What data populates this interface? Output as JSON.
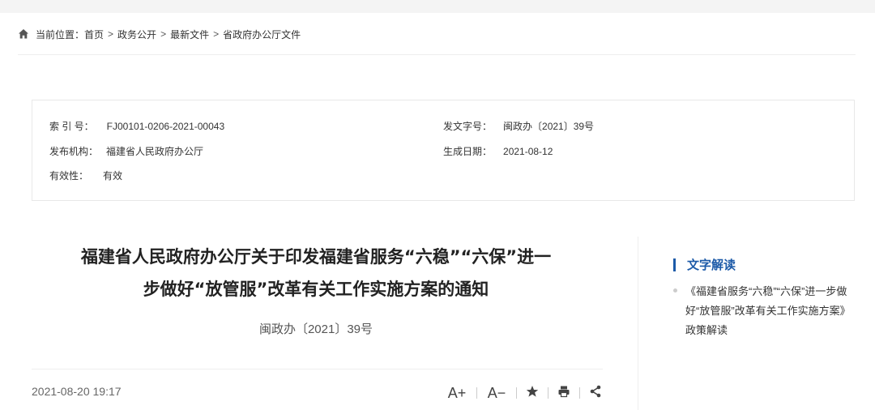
{
  "breadcrumb": {
    "prefix": "当前位置：",
    "items": [
      "首页",
      "政务公开",
      "最新文件",
      "省政府办公厅文件"
    ],
    "separator": ">"
  },
  "meta": {
    "index_label": "索 引 号：",
    "index_value": "FJ00101-0206-2021-00043",
    "docno_label": "发文字号：",
    "docno_value": "闽政办〔2021〕39号",
    "org_label": "发布机构：",
    "org_value": "福建省人民政府办公厅",
    "date_label": "生成日期：",
    "date_value": "2021-08-12",
    "validity_label": "有效性：",
    "validity_value": "有效"
  },
  "article": {
    "title_line1": "福建省人民政府办公厅关于印发福建省服务“六稳”“六保”进一",
    "title_line2": "步做好“放管服”改革有关工作实施方案的通知",
    "doc_number": "闽政办〔2021〕39号",
    "publish_time": "2021-08-20 19:17"
  },
  "tools": {
    "font_increase": "A+",
    "font_decrease": "A−"
  },
  "sidebar": {
    "title": "文字解读",
    "items": [
      "《福建省服务“六稳”“六保”进一步做好“放管服”改革有关工作实施方案》政策解读"
    ]
  },
  "colors": {
    "accent": "#1c5aa8",
    "text": "#333333",
    "border": "#e8e8e8"
  }
}
